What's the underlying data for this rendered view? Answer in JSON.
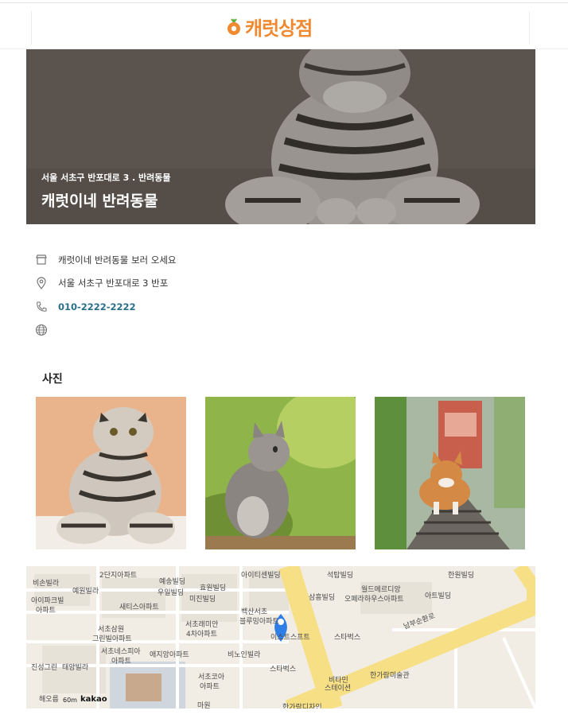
{
  "header": {
    "logo_text": "캐럿상점",
    "brand_color": "#f0892f"
  },
  "hero": {
    "address": "서울 서초구 반포대로 3 . 반려동물",
    "title": "캐럿이네 반려동물"
  },
  "info": {
    "description": "캐럿이네 반려동물 보러 오세요",
    "address": "서울 서초구 반포대로 3  반포",
    "phone": "010-2222-2222",
    "website": ""
  },
  "photos": {
    "title": "사진",
    "items": [
      {
        "icon": "scottish-fold-cat-photo"
      },
      {
        "icon": "kitten-photo"
      },
      {
        "icon": "corgi-photo"
      }
    ]
  },
  "map": {
    "labels": [
      "비손빌라",
      "2단지아파트",
      "예송빌딩",
      "효원빌딩",
      "아이티센빌딩",
      "석탑빌딩",
      "월드메르디앙",
      "한원빌딩",
      "예원빌라",
      "우일빌딩",
      "미진빌딩",
      "삼흥빌딩",
      "오페라하우스아파트",
      "아트빌딩",
      "아이파크빌",
      "아파트",
      "새티스아파트",
      "백산서초",
      "블루밍아파트",
      "서초래미안",
      "4차아파트",
      "남부순환로",
      "서초삼원",
      "그린빌아파트",
      "이스트스프트",
      "스타벅스",
      "서초네스피아",
      "아파트",
      "애지앙아파트",
      "비노인빌라",
      "스타벅스",
      "진성그린",
      "태양빌라",
      "서초코아",
      "아파트",
      "비타민",
      "스테이션",
      "한가람미술관",
      "해오름",
      "마원",
      "한가람디자인"
    ],
    "scale_text": "60m",
    "attribution": "kakao"
  }
}
